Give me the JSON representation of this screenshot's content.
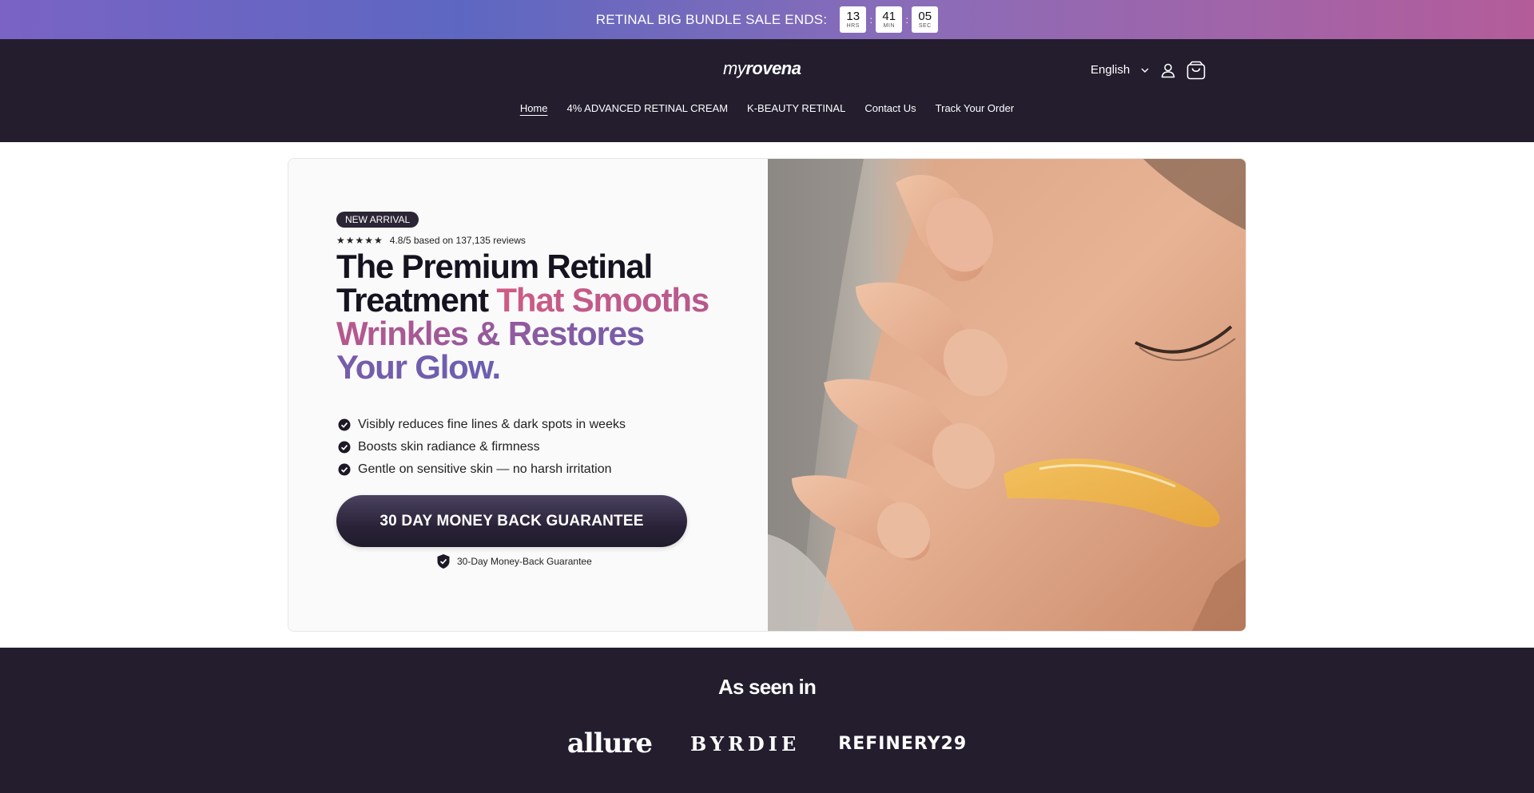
{
  "announcement": {
    "text": "RETINAL BIG BUNDLE SALE ENDS:",
    "timer": [
      {
        "value": "13",
        "label": "HRS"
      },
      {
        "value": "41",
        "label": "MIN"
      },
      {
        "value": "05",
        "label": "SEC"
      }
    ],
    "separator": ":"
  },
  "header": {
    "logo_light": "my",
    "logo_bold": "rovena",
    "language": "English",
    "icons": {
      "chevron": "chevron-down-icon",
      "account": "user-icon",
      "cart": "shopping-bag-icon"
    }
  },
  "nav": {
    "items": [
      {
        "label": "Home",
        "active": true
      },
      {
        "label": "4% ADVANCED RETINAL CREAM"
      },
      {
        "label": "K-BEAUTY RETINAL"
      },
      {
        "label": "Contact Us"
      },
      {
        "label": "Track Your Order"
      }
    ]
  },
  "hero": {
    "badge": "NEW ARRIVAL",
    "stars": "★★★★★",
    "rating_text": "4.8/5 based on 137,135 reviews",
    "headline_plain": "The Premium Retinal Treatment ",
    "headline_accent": "That Smooths Wrinkles & Restores Your Glow.",
    "benefits": [
      "Visibly reduces fine lines & dark spots in weeks",
      "Boosts skin radiance & firmness",
      "Gentle on sensitive skin — no harsh irritation"
    ],
    "cta_label": "30 DAY MONEY BACK GUARANTEE",
    "guarantee_text": "30-Day Money-Back Guarantee"
  },
  "press": {
    "title": "As seen in",
    "logos": [
      "allure",
      "BYRDIE",
      "REFINERY29"
    ]
  },
  "colors": {
    "header_bg": "#231d2e",
    "accent_pink": "#d05c84",
    "accent_purple": "#6a5fb2"
  }
}
